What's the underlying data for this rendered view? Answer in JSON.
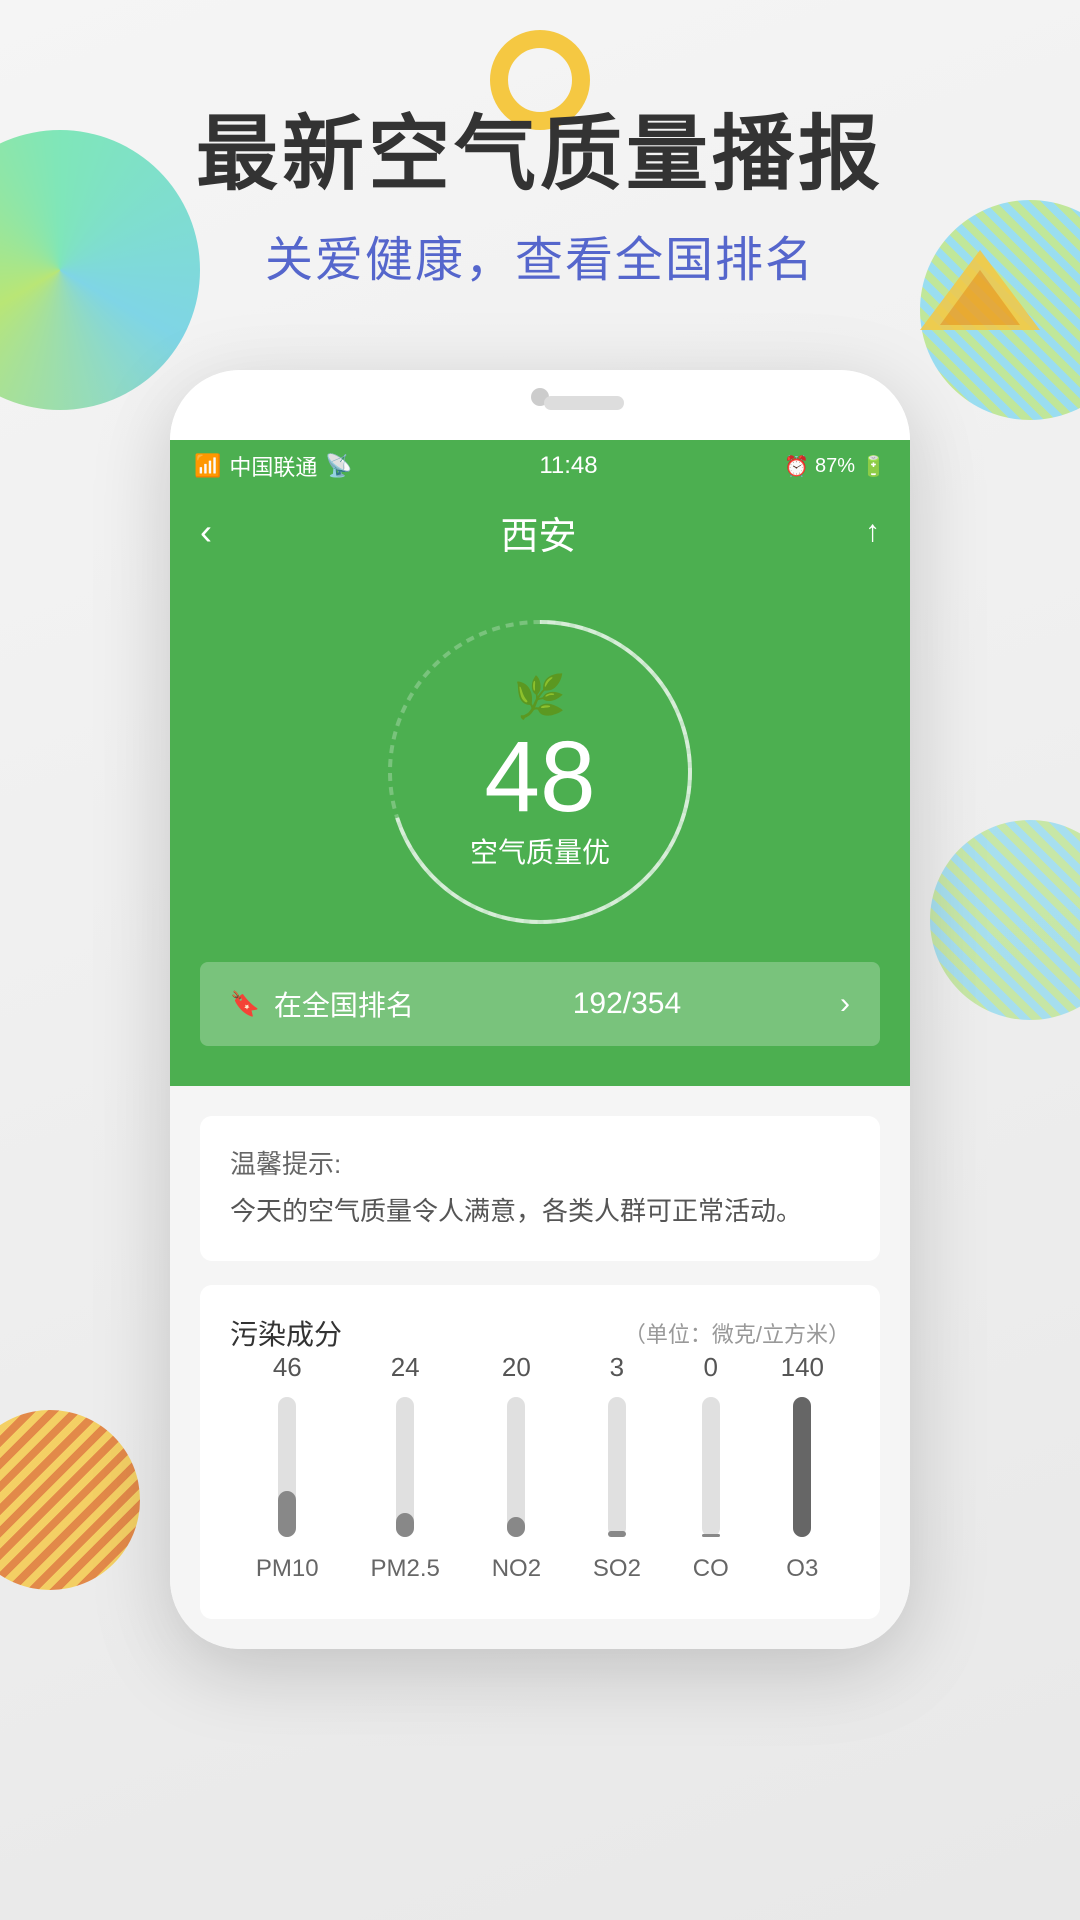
{
  "decorative": {},
  "headline": {
    "main_title": "最新空气质量播报",
    "sub_title": "关爱健康，查看全国排名"
  },
  "status_bar": {
    "carrier": "中国联通",
    "wifi": "WiFi",
    "time": "11:48",
    "alarm": "⏰",
    "battery_pct": "87%"
  },
  "app_header": {
    "back_label": "‹",
    "city": "西安",
    "share_label": "↑"
  },
  "aqi": {
    "value": "48",
    "label": "空气质量优"
  },
  "ranking": {
    "text": "在全国排名",
    "current": "192",
    "total": "354",
    "display": "192/354"
  },
  "tip": {
    "title": "温馨提示:",
    "text": "今天的空气质量令人满意，各类人群可正常活动。"
  },
  "pollution": {
    "section_title": "污染成分",
    "unit_label": "（单位：微克/立方米）",
    "items": [
      {
        "label": "PM10",
        "value": "46",
        "height_pct": 33
      },
      {
        "label": "PM2.5",
        "value": "24",
        "height_pct": 17
      },
      {
        "label": "NO2",
        "value": "20",
        "height_pct": 14
      },
      {
        "label": "SO2",
        "value": "3",
        "height_pct": 4
      },
      {
        "label": "CO",
        "value": "0",
        "height_pct": 2
      },
      {
        "label": "O3",
        "value": "140",
        "height_pct": 100
      }
    ]
  }
}
